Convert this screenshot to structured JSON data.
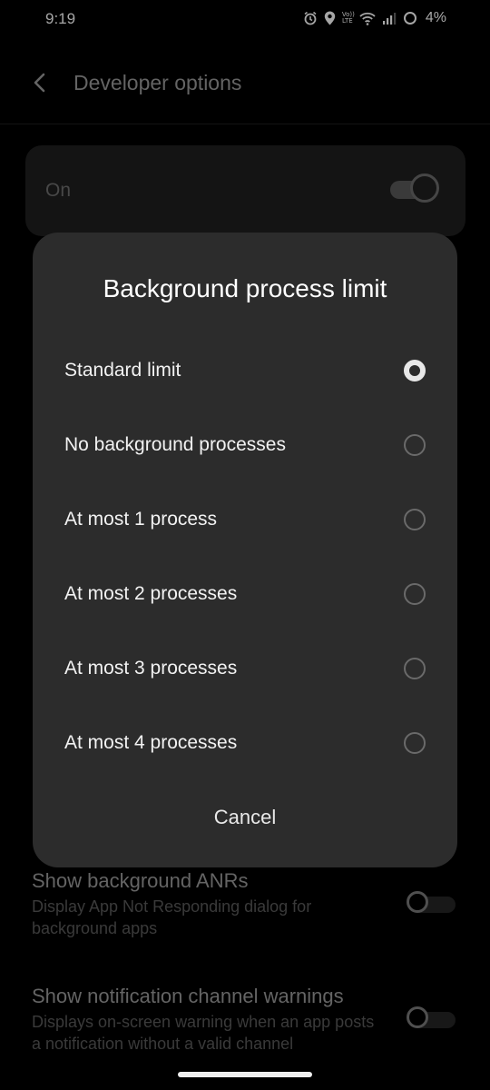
{
  "status_bar": {
    "time": "9:19",
    "volte_label": "Vo)) LTE",
    "battery": "4%"
  },
  "app_bar": {
    "title": "Developer options",
    "back_icon": "chevron-left-icon"
  },
  "master_switch": {
    "label": "On",
    "state": "on"
  },
  "background_settings": [
    {
      "title": "Show background ANRs",
      "summary": "Display App Not Responding dialog for background apps",
      "state": "off"
    },
    {
      "title": "Show notification channel warnings",
      "summary": "Displays on-screen warning when an app posts a notification without a valid channel",
      "state": "off"
    }
  ],
  "dialog": {
    "title": "Background process limit",
    "options": [
      {
        "label": "Standard limit",
        "checked": true
      },
      {
        "label": "No background processes",
        "checked": false
      },
      {
        "label": "At most 1 process",
        "checked": false
      },
      {
        "label": "At most 2 processes",
        "checked": false
      },
      {
        "label": "At most 3 processes",
        "checked": false
      },
      {
        "label": "At most 4 processes",
        "checked": false
      }
    ],
    "cancel_label": "Cancel"
  },
  "colors": {
    "background": "#000000",
    "dialog": "#2c2c2c",
    "card": "#1f1f1f",
    "primary_text": "#ffffff",
    "secondary_text": "#9a9a9a"
  }
}
